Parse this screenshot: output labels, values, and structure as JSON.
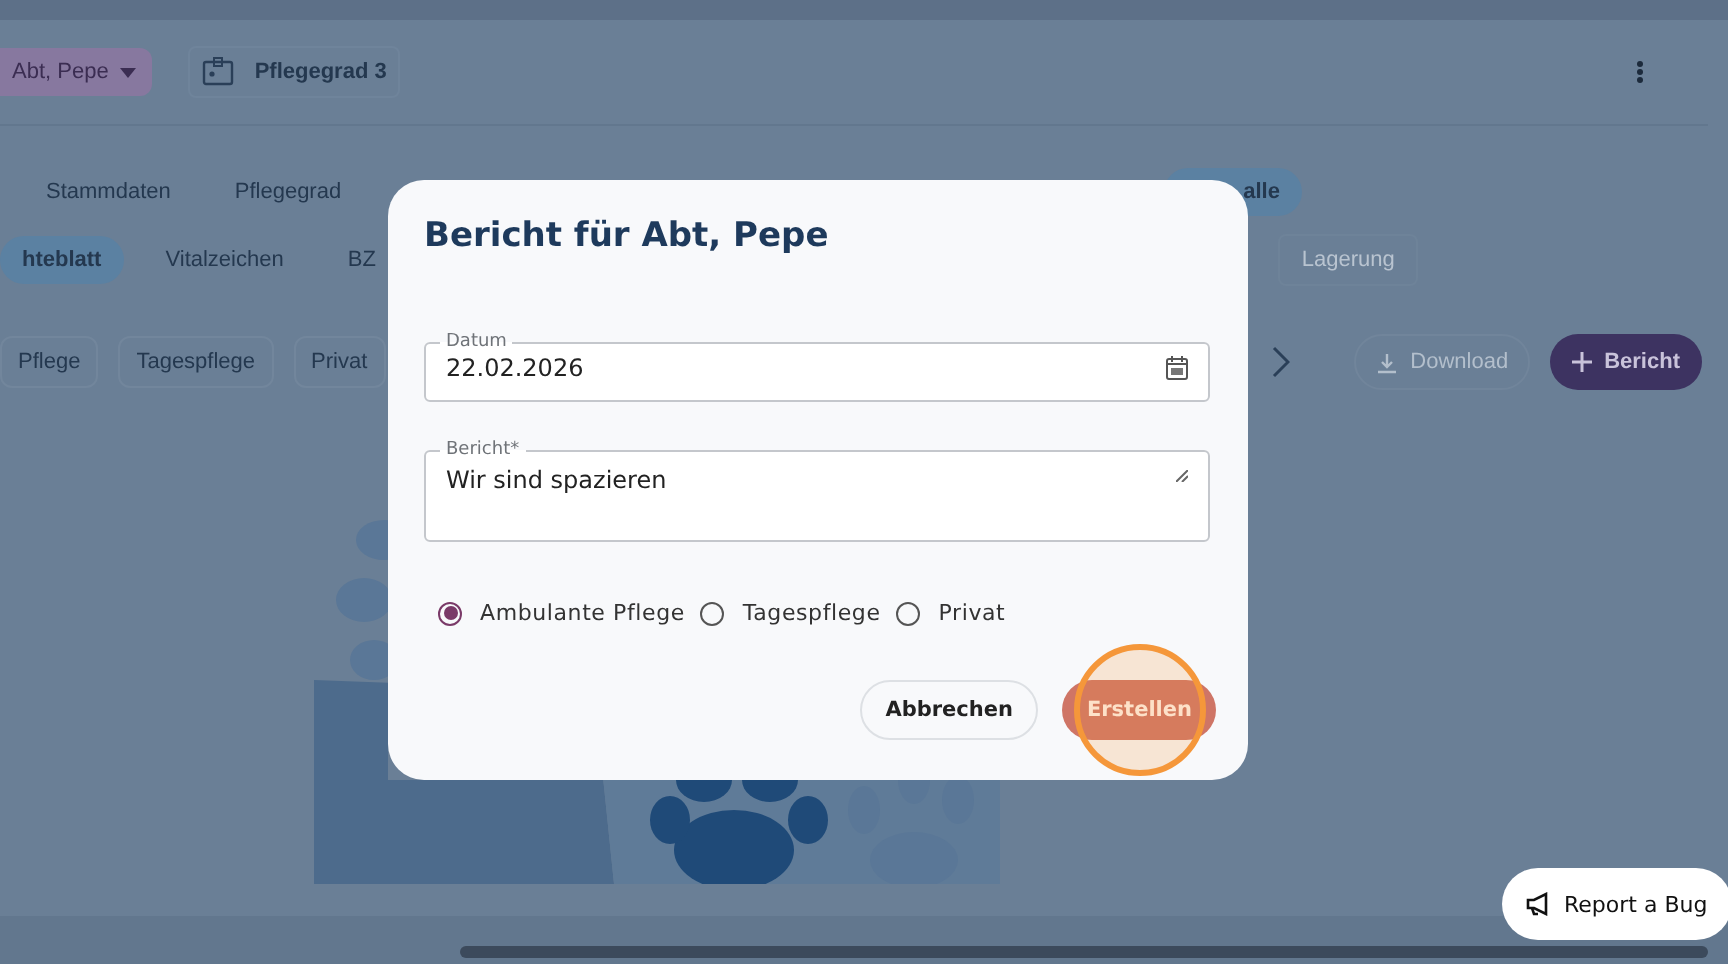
{
  "header": {
    "patient": "Abt, Pepe",
    "care_level": "Pflegegrad 3"
  },
  "tabs_primary": [
    {
      "label": "Stammdaten",
      "selected": false
    },
    {
      "label": "Pflegegrad",
      "selected": false
    },
    {
      "label": "alle",
      "selected": true
    }
  ],
  "tabs_secondary": [
    {
      "label": "hteblatt",
      "selected": true,
      "disabled": false
    },
    {
      "label": "Vitalzeichen",
      "selected": false,
      "disabled": false
    },
    {
      "label": "BZ",
      "selected": false,
      "disabled": false
    },
    {
      "label": "Lagerung",
      "selected": false,
      "disabled": true
    }
  ],
  "filters": [
    {
      "label": "Pflege"
    },
    {
      "label": "Tagespflege"
    },
    {
      "label": "Privat"
    }
  ],
  "toolbar": {
    "download": {
      "label": "Download",
      "disabled": true
    },
    "add": {
      "label": "Bericht"
    }
  },
  "dialog": {
    "title": "Bericht für Abt, Pepe",
    "date_field": {
      "label": "Datum",
      "value": "22.02.2026"
    },
    "report_field": {
      "label": "Bericht*",
      "value": "Wir sind spazieren"
    },
    "options": [
      {
        "label": "Ambulante Pflege",
        "selected": true
      },
      {
        "label": "Tagespflege",
        "selected": false
      },
      {
        "label": "Privat",
        "selected": false
      }
    ],
    "buttons": [
      {
        "label": "Abbrechen",
        "kind": "secondary",
        "highlighted": false
      },
      {
        "label": "Erstellen",
        "kind": "primary",
        "highlighted": true
      }
    ]
  },
  "report_bug": {
    "label": "Report a Bug"
  }
}
